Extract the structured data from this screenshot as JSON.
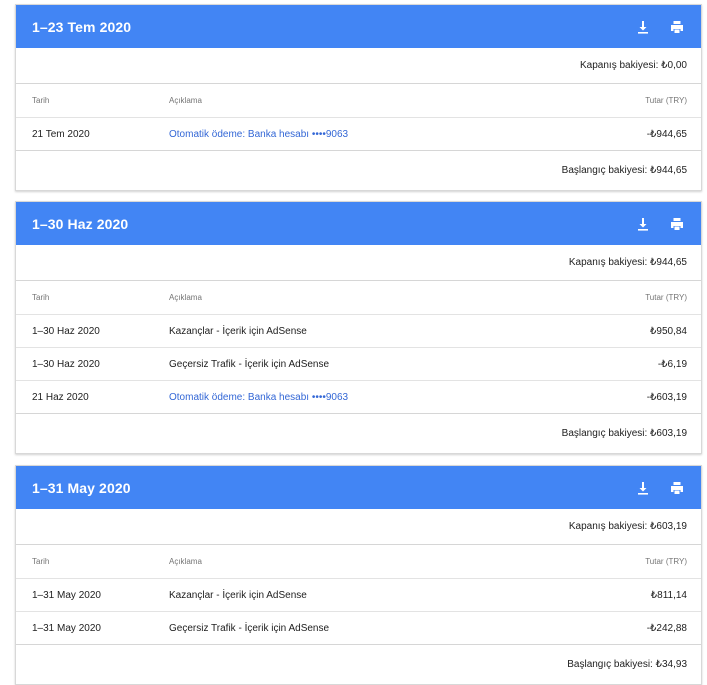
{
  "colors": {
    "header": "#4285f4",
    "link": "#3367d6"
  },
  "statements": [
    {
      "title": "1–23 Tem 2020",
      "closing_balance": "Kapanış bakiyesi: ₺0,00",
      "columns": {
        "date": "Tarih",
        "description": "Açıklama",
        "amount": "Tutar (TRY)"
      },
      "rows": [
        {
          "date": "21 Tem 2020",
          "description": "Otomatik ödeme: Banka hesabı ••••9063",
          "amount": "-₺944,65"
        }
      ],
      "opening_balance": "Başlangıç bakiyesi: ₺944,65"
    },
    {
      "title": "1–30 Haz 2020",
      "closing_balance": "Kapanış bakiyesi: ₺944,65",
      "columns": {
        "date": "Tarih",
        "description": "Açıklama",
        "amount": "Tutar (TRY)"
      },
      "rows": [
        {
          "date": "1–30 Haz 2020",
          "description": "Kazançlar - İçerik için AdSense",
          "amount": "₺950,84"
        },
        {
          "date": "1–30 Haz 2020",
          "description": "Geçersiz Trafik - İçerik için AdSense",
          "amount": "-₺6,19"
        },
        {
          "date": "21 Haz 2020",
          "description": "Otomatik ödeme: Banka hesabı ••••9063",
          "amount": "-₺603,19"
        }
      ],
      "opening_balance": "Başlangıç bakiyesi: ₺603,19"
    },
    {
      "title": "1–31 May 2020",
      "closing_balance": "Kapanış bakiyesi: ₺603,19",
      "columns": {
        "date": "Tarih",
        "description": "Açıklama",
        "amount": "Tutar (TRY)"
      },
      "rows": [
        {
          "date": "1–31 May 2020",
          "description": "Kazançlar - İçerik için AdSense",
          "amount": "₺811,14"
        },
        {
          "date": "1–31 May 2020",
          "description": "Geçersiz Trafik - İçerik için AdSense",
          "amount": "-₺242,88"
        }
      ],
      "opening_balance": "Başlangıç bakiyesi: ₺34,93"
    }
  ],
  "icons": {
    "download": "download-icon",
    "print": "print-icon"
  }
}
